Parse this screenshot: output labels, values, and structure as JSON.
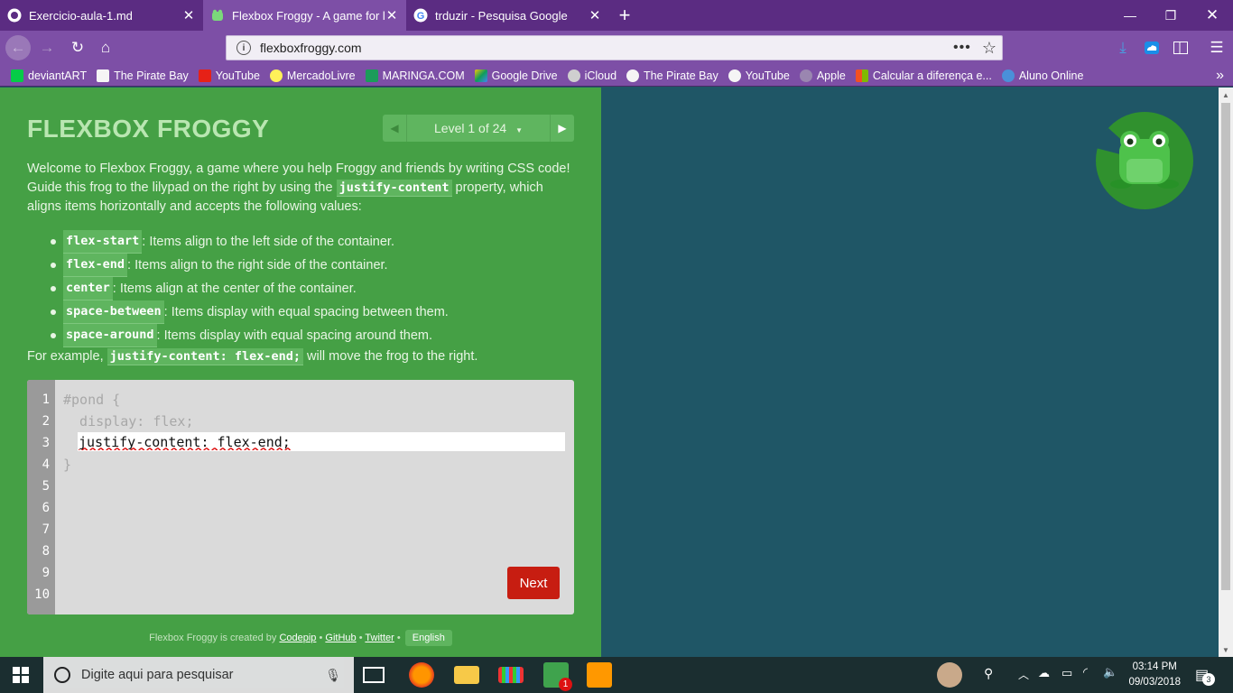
{
  "browser": {
    "tabs": [
      {
        "label": "Exercicio-aula-1.md",
        "icon": "github-icon",
        "active": false
      },
      {
        "label": "Flexbox Froggy - A game for le",
        "icon": "frog-favicon",
        "active": true
      },
      {
        "label": "trduzir - Pesquisa Google",
        "icon": "google-icon",
        "active": false
      }
    ],
    "url": "flexboxfroggy.com",
    "bookmarks": [
      {
        "label": "deviantART",
        "color": "#05cc47"
      },
      {
        "label": "The Pirate Bay",
        "color": "#f5f5f5"
      },
      {
        "label": "YouTube",
        "color": "#e62117"
      },
      {
        "label": "MercadoLivre",
        "color": "#fff159"
      },
      {
        "label": "MARINGA.COM",
        "color": "#1b9c5a"
      },
      {
        "label": "Google Drive",
        "color": "#f4c20d"
      },
      {
        "label": "iCloud",
        "color": "#cfcfcf"
      },
      {
        "label": "The Pirate Bay",
        "color": "#f5f5f5"
      },
      {
        "label": "YouTube",
        "color": "#f5f5f5"
      },
      {
        "label": "Apple",
        "color": "#9a86b0"
      },
      {
        "label": "Calcular a diferença e...",
        "color": "#ff6a00"
      },
      {
        "label": "Aluno Online",
        "color": "#4a90d9"
      }
    ]
  },
  "game": {
    "title": "FLEXBOX FROGGY",
    "level": "Level 1 of 24",
    "intro_a": "Welcome to Flexbox Froggy, a game where you help Froggy and friends by writing CSS code! Guide this frog to the lilypad on the right by using the ",
    "intro_code": "justify-content",
    "intro_b": " property, which aligns items horizontally and accepts the following values:",
    "values": [
      {
        "code": "flex-start",
        "desc": ": Items align to the left side of the container."
      },
      {
        "code": "flex-end",
        "desc": ": Items align to the right side of the container."
      },
      {
        "code": "center",
        "desc": ": Items align at the center of the container."
      },
      {
        "code": "space-between",
        "desc": ": Items display with equal spacing between them."
      },
      {
        "code": "space-around",
        "desc": ": Items display with equal spacing around them."
      }
    ],
    "example_a": "For example, ",
    "example_code": "justify-content: flex-end;",
    "example_b": " will move the frog to the right.",
    "editor": {
      "line_numbers": [
        "1",
        "2",
        "3",
        "4",
        "5",
        "6",
        "7",
        "8",
        "9",
        "10"
      ],
      "line1": "#pond {",
      "line2": "  display: flex;",
      "input_value": "justify-content: flex-end;",
      "line4": "}"
    },
    "next_label": "Next",
    "footer": {
      "created_by": "Flexbox Froggy is created by ",
      "codepip": "Codepip",
      "sep": " • ",
      "github": "GitHub",
      "twitter": "Twitter",
      "lang": "English"
    },
    "colors": {
      "panel": "#45a045",
      "pond": "#1f5666",
      "lilypad": "#30912e",
      "frog": "#6fd26c",
      "next": "#c71d11"
    }
  },
  "taskbar": {
    "search_placeholder": "Digite aqui para pesquisar",
    "time": "03:14 PM",
    "date": "09/03/2018",
    "notification_count": "3",
    "whatsapp_badge": "1"
  }
}
